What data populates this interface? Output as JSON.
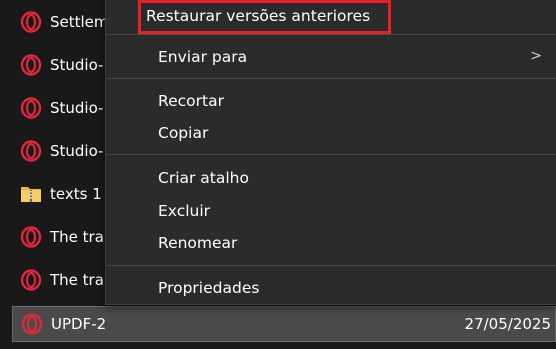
{
  "file_list": {
    "items": [
      {
        "name": "Settlem",
        "icon": "opera-icon"
      },
      {
        "name": "Studio-",
        "icon": "opera-icon"
      },
      {
        "name": "Studio-",
        "icon": "opera-icon"
      },
      {
        "name": "Studio-",
        "icon": "opera-icon"
      },
      {
        "name": "texts 1",
        "icon": "folder-zip-icon"
      },
      {
        "name": "The tra",
        "icon": "opera-icon"
      },
      {
        "name": "The tra",
        "icon": "opera-icon"
      },
      {
        "name": "UPDF-2",
        "icon": "opera-icon",
        "date": "27/05/2025",
        "selected": true
      }
    ]
  },
  "context_menu": {
    "restore_previous_versions": "Restaurar versões anteriores",
    "send_to": "Enviar para",
    "cut": "Recortar",
    "copy": "Copiar",
    "create_shortcut": "Criar atalho",
    "delete": "Excluir",
    "rename": "Renomear",
    "properties": "Propriedades",
    "submenu_arrow": ">"
  },
  "colors": {
    "highlight": "#e8202a",
    "opera_red": "#e0283c",
    "menu_bg": "#2b2b2b",
    "page_bg": "#191919"
  }
}
